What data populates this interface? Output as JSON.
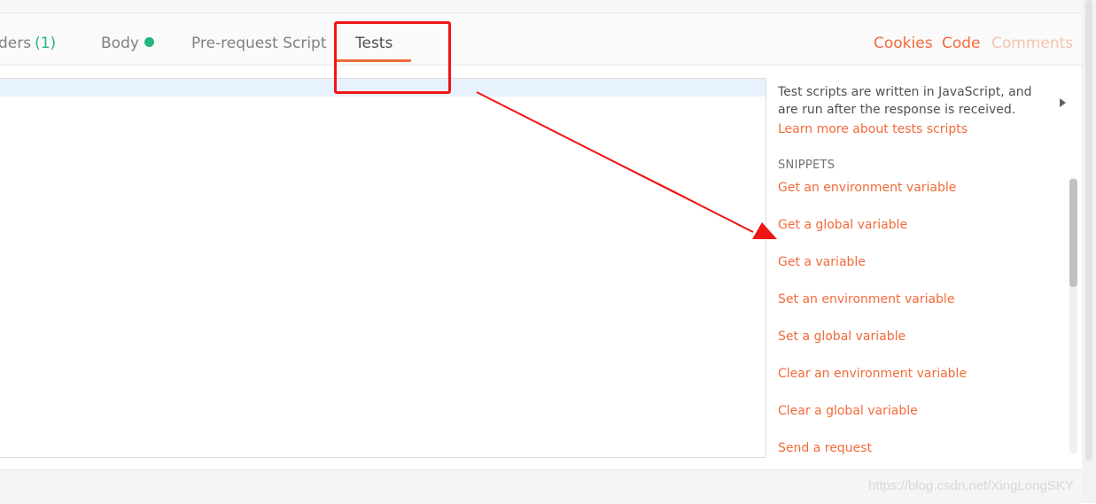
{
  "tabs": {
    "headers_label": "ders",
    "headers_count": "(1)",
    "body_label": "Body",
    "prerequest_label": "Pre-request Script",
    "tests_label": "Tests"
  },
  "right_links": {
    "cookies": "Cookies",
    "code": "Code",
    "comments": "Comments"
  },
  "sidebar": {
    "description": "Test scripts are written in JavaScript, and are run after the response is received.",
    "learn_more": "Learn more about tests scripts",
    "snippets_heading": "SNIPPETS",
    "snippets": [
      "Get an environment variable",
      "Get a global variable",
      "Get a variable",
      "Set an environment variable",
      "Set a global variable",
      "Clear an environment variable",
      "Clear a global variable",
      "Send a request"
    ]
  },
  "watermark": "https://blog.csdn.net/XingLongSKY",
  "colors": {
    "accent": "#f26b3a",
    "status_green": "#26b47f",
    "annotation_red": "#f01515"
  }
}
